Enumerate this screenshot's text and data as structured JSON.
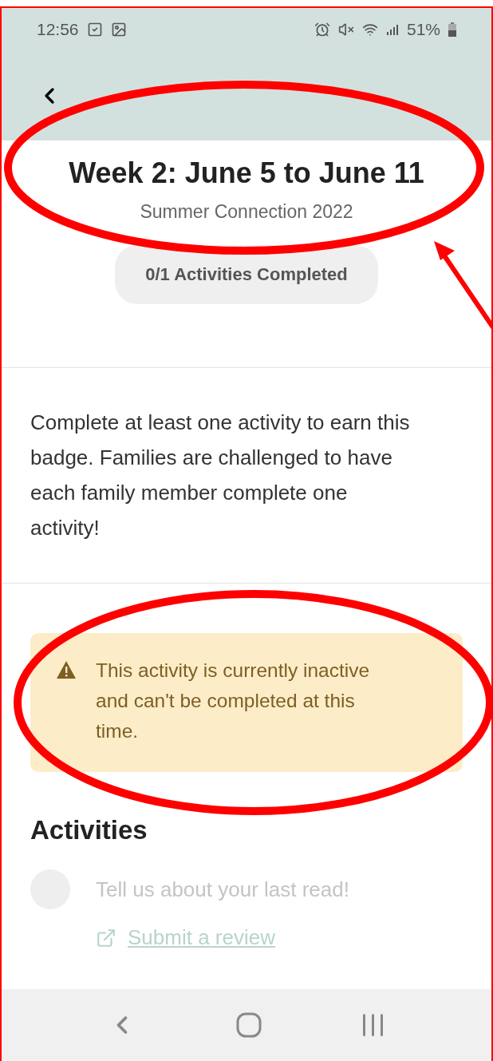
{
  "status_bar": {
    "time": "12:56",
    "battery": "51%"
  },
  "title": "Week 2: June 5 to June 11",
  "subtitle": "Summer Connection 2022",
  "progress_badge": "0/1 Activities Completed",
  "description": "Complete at least one activity to earn this badge. Families are challenged to have each family member complete one activity!",
  "warning": "This activity is currently inactive and can't be completed at this time.",
  "activities_heading": "Activities",
  "activities": [
    {
      "label": "Tell us about your last read!",
      "disabled": true,
      "link": "Submit a review"
    }
  ],
  "annotations": [
    {
      "kind": "ellipse"
    },
    {
      "kind": "ellipse"
    },
    {
      "kind": "arrow"
    }
  ]
}
